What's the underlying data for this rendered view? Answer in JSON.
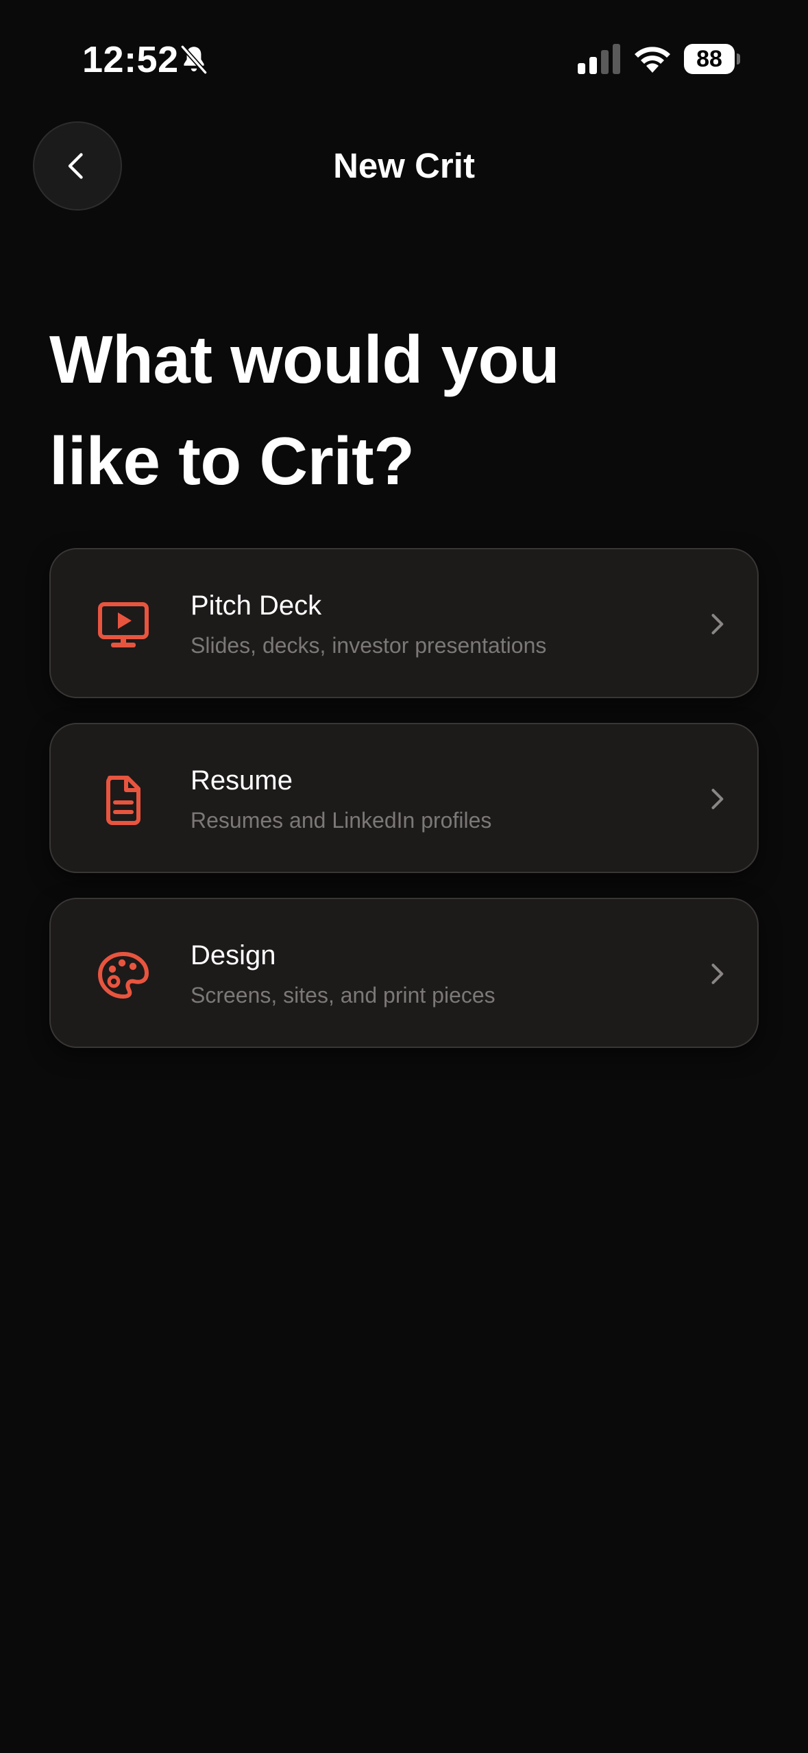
{
  "status_bar": {
    "time": "12:52",
    "battery": "88",
    "battery_level_percent": 88,
    "icons": [
      "bell-off-icon",
      "signal-icon",
      "wifi-icon",
      "battery-icon"
    ]
  },
  "header": {
    "title": "New Crit",
    "back_icon": "chevron-left-icon"
  },
  "main": {
    "heading_line1": "What would you",
    "heading_line2": "like to Crit?",
    "options": [
      {
        "title": "Pitch Deck",
        "subtitle": "Slides, decks, investor presentations",
        "icon": "presentation-icon"
      },
      {
        "title": "Resume",
        "subtitle": "Resumes and LinkedIn profiles",
        "icon": "document-icon"
      },
      {
        "title": "Design",
        "subtitle": "Screens, sites, and print pieces",
        "icon": "palette-icon"
      }
    ]
  },
  "colors": {
    "background": "#0a0a0a",
    "card": "#1d1a1a",
    "accent": "#e8553f",
    "subtitle": "#7c7878"
  }
}
